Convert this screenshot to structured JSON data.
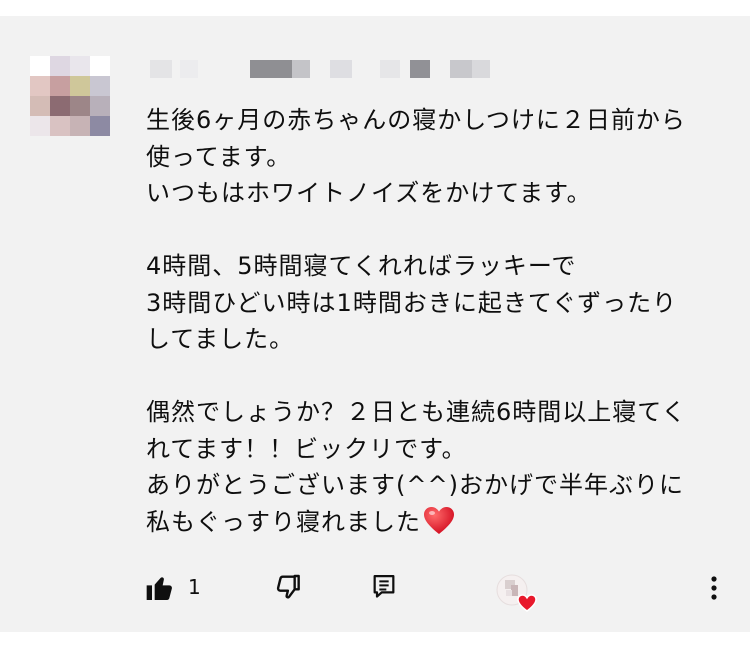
{
  "comment": {
    "author_hidden": true,
    "lines": [
      "生後6ヶ月の赤ちゃんの寝かしつけに２日前から",
      "使ってます。",
      "いつもはホワイトノイズをかけてます。",
      "",
      "4時間、5時間寝てくれればラッキーで",
      "3時間ひどい時は1時間おきに起きてぐずったり",
      "してました。",
      "",
      "偶然でしょうか？２日とも連続6時間以上寝てく",
      "れてます！！ビックリです。",
      "ありがとうございます(^^)おかげで半年ぶりに",
      "私もぐっすり寝れました"
    ],
    "end_emoji": "red-heart"
  },
  "actions": {
    "like_count": "1",
    "like_icon": "thumbs-up-icon",
    "dislike_icon": "thumbs-down-icon",
    "reply_icon": "reply-icon",
    "creator_heart_icon": "creator-heart-icon",
    "more_icon": "more-vertical-icon"
  },
  "colors": {
    "card_background": "#f2f2f2",
    "text": "#0f0f0f",
    "heart_red": "#e8192c"
  }
}
